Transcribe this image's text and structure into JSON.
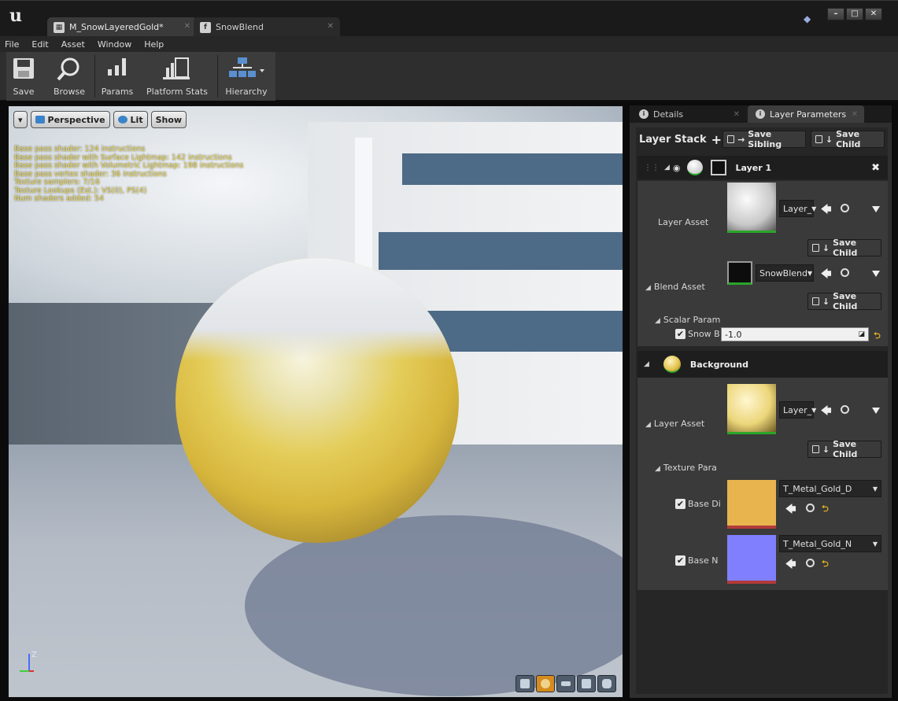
{
  "tabs": [
    {
      "label": "M_SnowLayeredGold*",
      "icon": "material-icon"
    },
    {
      "label": "SnowBlend",
      "icon": "material-function-icon"
    }
  ],
  "menu": [
    "File",
    "Edit",
    "Asset",
    "Window",
    "Help"
  ],
  "toolbar": {
    "save": "Save",
    "browse": "Browse",
    "params": "Params",
    "platform_stats": "Platform Stats",
    "hierarchy": "Hierarchy"
  },
  "viewport": {
    "menu_button": "▾",
    "perspective": "Perspective",
    "lit": "Lit",
    "show": "Show",
    "stats": [
      "Base pass shader: 124 instructions",
      "Base pass shader with Surface Lightmap: 142 instructions",
      "Base pass shader with Volumetric Lightmap: 198 instructions",
      "Base pass vertex shader: 36 instructions",
      "Texture samplers: 7/16",
      "Texture Lookups (Est.): VS(0), PS(4)",
      "Num shaders added: 54"
    ],
    "axis_label": "Z"
  },
  "panel": {
    "tabs": [
      "Details",
      "Layer Parameters"
    ],
    "layer_stack": "Layer Stack",
    "save_sibling": "Save Sibling",
    "save_child": "Save Child",
    "layer1": {
      "name": "Layer 1",
      "layer_asset_label": "Layer Asset",
      "layer_asset_value": "Layer_",
      "blend_asset_label": "Blend Asset",
      "blend_asset_value": "SnowBlend",
      "scalar_param_label": "Scalar Param",
      "snow_param_label": "Snow B",
      "snow_param_value": "-1.0"
    },
    "background": {
      "name": "Background",
      "layer_asset_label": "Layer Asset",
      "layer_asset_value": "Layer_",
      "texture_param_label": "Texture Para",
      "base_diffuse_label": "Base Di",
      "base_diffuse_value": "T_Metal_Gold_D",
      "base_normal_label": "Base N",
      "base_normal_value": "T_Metal_Gold_N"
    }
  },
  "colors": {
    "stats_text": "#e8d44d",
    "active_green": "#2aa52a",
    "gold_texture": "#e8b44e",
    "normal_texture": "#8080ff"
  }
}
